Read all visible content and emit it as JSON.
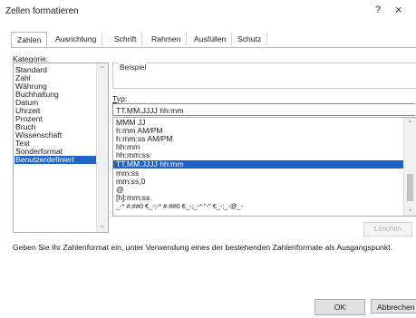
{
  "window": {
    "title": "Zellen formatieren",
    "help": "?",
    "close": "×"
  },
  "tabs": [
    {
      "label": "Zahlen"
    },
    {
      "label": "Ausrichtung"
    },
    {
      "label": "Schrift"
    },
    {
      "label": "Rahmen"
    },
    {
      "label": "Ausfüllen"
    },
    {
      "label": "Schutz"
    }
  ],
  "kategorie": {
    "label": "Kategorie:",
    "items": [
      "Standard",
      "Zahl",
      "Währung",
      "Buchhaltung",
      "Datum",
      "Uhrzeit",
      "Prozent",
      "Bruch",
      "Wissenschaft",
      "Text",
      "Sonderformat",
      "Benutzerdefiniert"
    ],
    "selected": "Benutzerdefiniert"
  },
  "beispiel": {
    "label": "Beispiel"
  },
  "typ": {
    "label": "Typ:",
    "value": "TT.MM.JJJJ hh:mm"
  },
  "formats": {
    "items": [
      "MMM JJ",
      "h:mm AM/PM",
      "h:mm:ss AM/PM",
      "hh:mm",
      "hh:mm:ss",
      "TT.MM.JJJJ hh:mm",
      "mm:ss",
      "mm:ss,0",
      "@",
      "[h]:mm:ss",
      "_-* #.##0 €_-;-* #.##0 €_-;_-* \"-\" €_-;_-@_-"
    ],
    "selected": "TT.MM.JJJJ hh:mm"
  },
  "buttons": {
    "delete": "Löschen",
    "ok": "OK",
    "cancel": "Abbrechen"
  },
  "info_text": "Geben Sie Ihr Zahlenformat ein, unter Verwendung eines der bestehenden Zahlenformate als Ausgangspunkt."
}
